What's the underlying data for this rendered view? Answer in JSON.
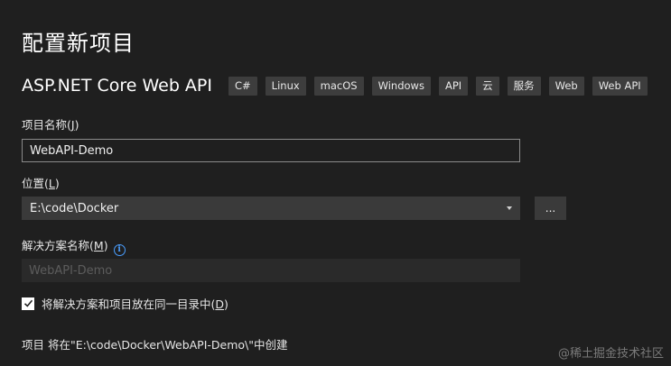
{
  "title": "配置新项目",
  "template": {
    "name": "ASP.NET Core Web API",
    "tags": [
      "C#",
      "Linux",
      "macOS",
      "Windows",
      "API",
      "云",
      "服务",
      "Web",
      "Web API"
    ]
  },
  "project_name": {
    "label_prefix": "项目名称(",
    "access_key": "J",
    "label_suffix": ")",
    "value": "WebAPI-Demo"
  },
  "location": {
    "label_prefix": "位置(",
    "access_key": "L",
    "label_suffix": ")",
    "value": "E:\\code\\Docker",
    "browse_label": "..."
  },
  "solution_name": {
    "label_prefix": "解决方案名称(",
    "access_key": "M",
    "label_suffix": ")",
    "value": "WebAPI-Demo",
    "info_icon": "i"
  },
  "same_directory": {
    "checked": true,
    "label_prefix": "将解决方案和项目放在同一目录中(",
    "access_key": "D",
    "label_suffix": ")"
  },
  "summary": "项目 将在\"E:\\code\\Docker\\WebAPI-Demo\\\"中创建",
  "watermark": "@稀土掘金技术社区"
}
